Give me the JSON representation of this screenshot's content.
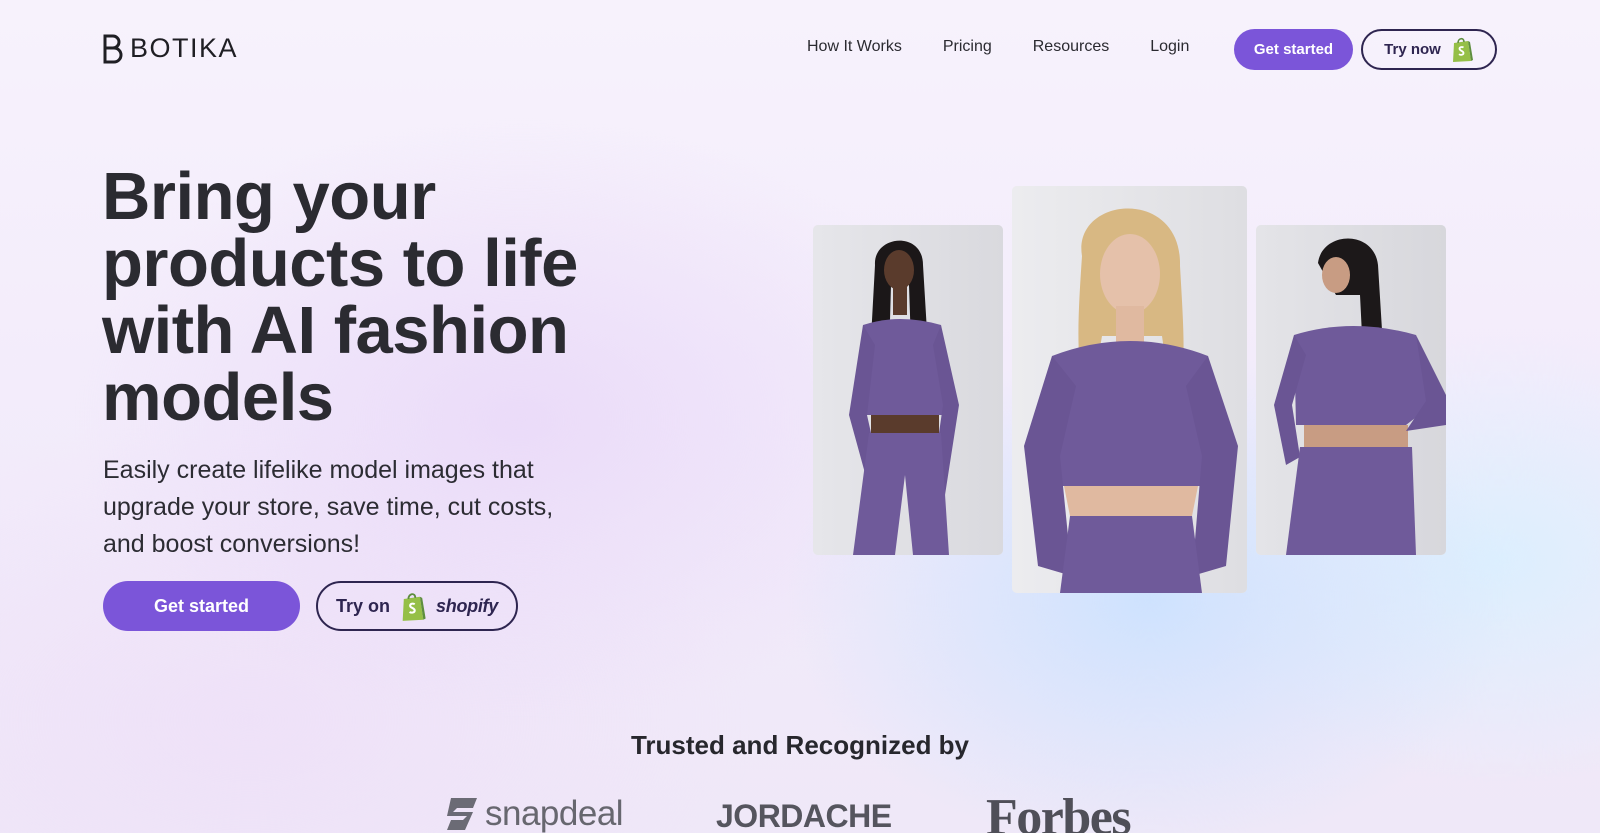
{
  "nav": {
    "brand": "BOTIKA",
    "links": [
      "How It Works",
      "Pricing",
      "Resources",
      "Login"
    ],
    "cta_primary": "Get started",
    "cta_secondary": "Try now"
  },
  "hero": {
    "title": "Bring your products to life with AI fashion models",
    "subtitle": "Easily create lifelike model images that upgrade your store, save time, cut costs, and boost conversions!",
    "cta_primary": "Get started",
    "cta_secondary_prefix": "Try on",
    "cta_secondary_brand": "shopify"
  },
  "trusted": {
    "title": "Trusted and Recognized by",
    "brands": [
      "snapdeal",
      "JORDACHE",
      "Forbes"
    ]
  },
  "colors": {
    "accent": "#7b55d9",
    "outline": "#2e2550",
    "text": "#2b2b31",
    "garment": "#6f5a9a",
    "shopify_green": "#95bf47"
  },
  "icons": {
    "logo_mark": "botika-logo-icon",
    "shopify": "shopify-bag-icon",
    "snapdeal": "snapdeal-logo-icon"
  }
}
